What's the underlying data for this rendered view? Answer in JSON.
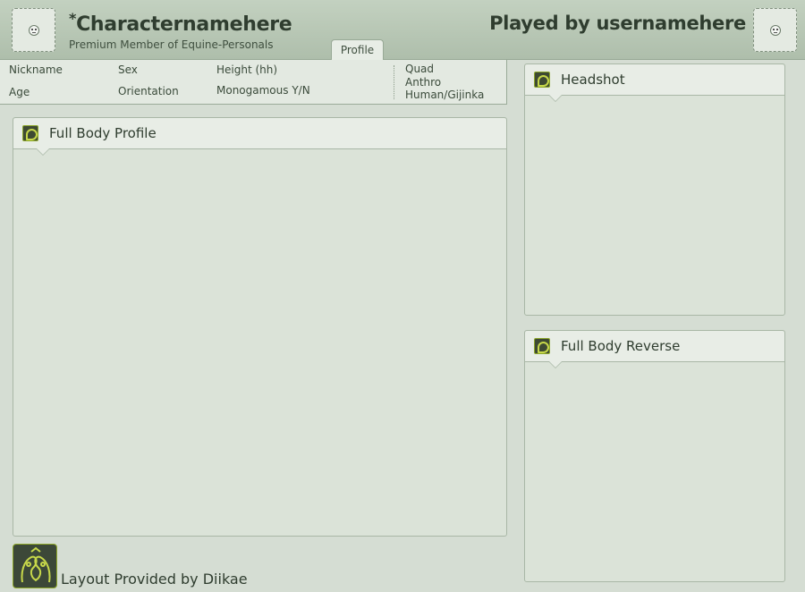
{
  "header": {
    "star": "*",
    "character_name": "Characternamehere",
    "member_line": "Premium Member of Equine-Personals",
    "tab_label": "Profile",
    "played_by": "Played by usernamehere",
    "left_avatar_icon": "smiley-icon",
    "right_avatar_icon": "smiley-icon"
  },
  "stats": {
    "nickname": "Nickname",
    "sex": "Sex",
    "height": "Height (hh)",
    "age": "Age",
    "orientation": "Orientation",
    "monogamous": "Monogamous Y/N",
    "forms": [
      "Quad",
      "Anthro",
      "Human/Gijinka"
    ]
  },
  "panels": {
    "full_body": "Full Body Profile",
    "headshot": "Headshot",
    "reverse": "Full Body Reverse"
  },
  "footer": {
    "credit": "Layout Provided by Diikae"
  },
  "colors": {
    "background": "#d5ddd3",
    "header": "#aebeab",
    "accent": "#8ca62a"
  }
}
